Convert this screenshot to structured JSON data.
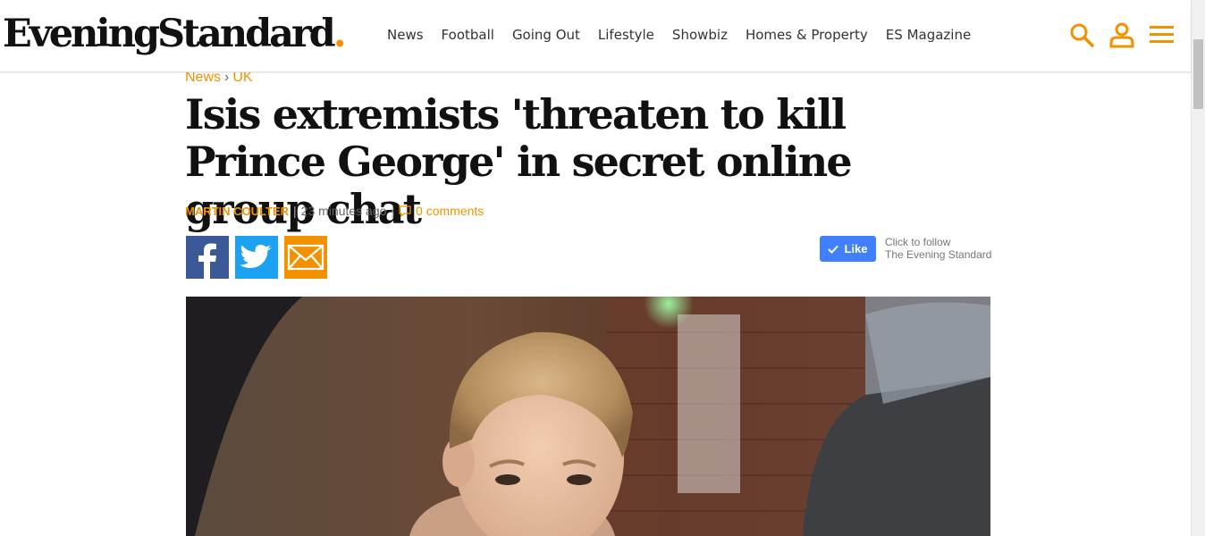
{
  "header": {
    "logo_text": "EveningStandard",
    "logo_dot": ".",
    "nav": [
      "News",
      "Football",
      "Going Out",
      "Lifestyle",
      "Showbiz",
      "Homes & Property",
      "ES Magazine"
    ]
  },
  "article": {
    "breadcrumb": [
      "News",
      "UK"
    ],
    "breadcrumb_sep": "›",
    "headline": "Isis extremists 'threaten to kill Prince George' in secret online group chat",
    "author": "MARTIN COULTER",
    "time": "23 minutes ago",
    "comments": "0 comments",
    "like_label": "Like",
    "follow_line1": "Click to follow",
    "follow_line2": "The Evening Standard"
  },
  "icons": [
    "search-icon",
    "user-icon",
    "menu-icon",
    "facebook-icon",
    "twitter-icon",
    "email-icon",
    "comment-icon",
    "check-icon"
  ],
  "colors": {
    "accent": "#f39200",
    "facebook": "#3b5998",
    "twitter": "#1da1f2",
    "like": "#4080ff",
    "text": "#111111"
  }
}
